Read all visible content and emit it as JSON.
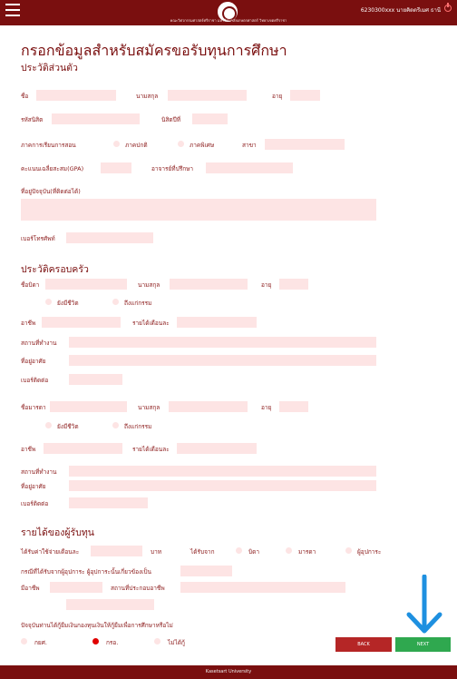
{
  "header": {
    "faculty": "คณะวิศวกรรมศาสตร์ศรีราชา มหาวิทยาลัยเกษตรศาสตร์ วิทยาเขตศรีราชา",
    "user": "6230300xxx นายคิดตรีเมศ ธานี"
  },
  "form": {
    "title": "กรอกข้อมูลสำหรับสมัครขอรับทุนการศึกษา",
    "personal_heading": "ประวัติส่วนตัว",
    "name": "ชื่อ",
    "surname": "นามสกุล",
    "age": "อายุ",
    "student_id": "รหัสนิสิต",
    "year": "นิสิตปีที่",
    "program": "ภาคการเรียนการสอน",
    "regular": "ภาคปกติ",
    "special": "ภาคพิเศษ",
    "major": "สาขา",
    "gpa": "คะแนนเฉลี่ยสะสม(GPA)",
    "advisor": "อาจารย์ที่ปรึกษา",
    "address": "ที่อยู่ปัจจุบัน(ที่ติดต่อได้)",
    "phone": "เบอร์โทรศัพท์"
  },
  "family": {
    "heading": "ประวัติครอบครัว",
    "father": "ชื่อบิดา",
    "mother": "ชื่อมารดา",
    "surname": "นามสกุล",
    "age": "อายุ",
    "alive": "ยังมีชีวิต",
    "dead": "ถึงแก่กรรม",
    "occupation": "อาชีพ",
    "income": "รายได้เดือนละ",
    "workplace": "สถานที่ทำงาน",
    "residence": "ที่อยู่อาศัย",
    "contact": "เบอร์ติดต่อ"
  },
  "income": {
    "heading": "รายได้ของผู้รับทุน",
    "monthly": "ได้รับค่าใช้จ่ายเดือนละ",
    "baht": "บาท",
    "from": "ได้รับจาก",
    "father": "บิดา",
    "mother": "มารดา",
    "guardian": "ผู้อุปการะ",
    "guardian_note": "กรณีที่ได้รับจากผู้อุปการะ ผู้อุปการะนั้นเกี่ยวข้องเป็น",
    "occupation": "มีอาชีพ",
    "workplace": "สถานที่ประกอบอาชีพ",
    "loan_q": "ปัจจุบันท่านได้กู้ยืมเงินกองทุนเงินให้กู้ยืมเพื่อการศึกษาหรือไม่",
    "loan_a": "กยศ.",
    "loan_b": "กรอ.",
    "loan_c": "ไม่ได้กู้"
  },
  "buttons": {
    "back": "BACK",
    "next": "NEXT"
  },
  "footer": "Kasetsart University"
}
